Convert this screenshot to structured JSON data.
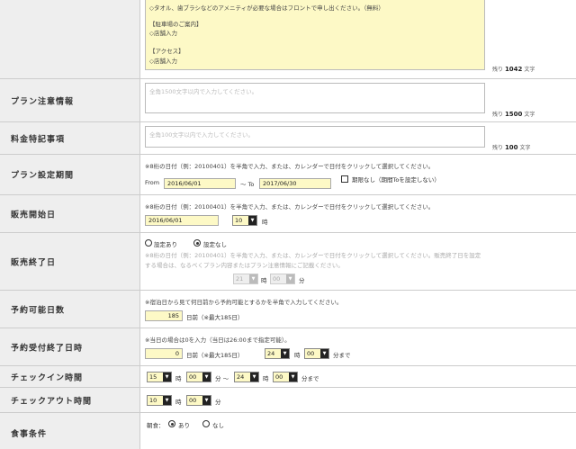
{
  "rows": {
    "top": {
      "lines": [
        "◇タオル、歯ブラシなどのアメニティが必要な場合はフロントで申し出ください。（無料）",
        "",
        "【駐車場のご案内】",
        "◇店舗入力",
        "",
        "【アクセス】",
        "◇店舗入力"
      ],
      "remain_prefix": "残り",
      "remain_count": "1042",
      "remain_suffix": "文字"
    },
    "plan_notes": {
      "label": "プラン注意情報",
      "placeholder": "全角1500文字以内で入力してください。",
      "remain_prefix": "残り",
      "remain_count": "1500",
      "remain_suffix": "文字"
    },
    "fee_notes": {
      "label": "料金特記事項",
      "placeholder": "全角100文字以内で入力してください。",
      "remain_prefix": "残り",
      "remain_count": "100",
      "remain_suffix": "文字"
    },
    "plan_period": {
      "label": "プラン設定期間",
      "note": "※8桁の日付（例：20100401）を半角で入力、または、カレンダーで日付をクリックして選択してください。",
      "from_label": "From",
      "from_value": "2016/06/01",
      "to_label": "～ To",
      "to_value": "2017/06/30",
      "no_limit_label": "期限なし（期間Toを設定しない）"
    },
    "sale_start": {
      "label": "販売開始日",
      "note": "※8桁の日付（例：20100401）を半角で入力、または、カレンダーで日付をクリックして選択してください。",
      "date_value": "2016/06/01",
      "hour_value": "10",
      "hour_unit": "時"
    },
    "sale_end": {
      "label": "販売終了日",
      "radio_set": "設定あり",
      "radio_unset": "設定なし",
      "note1": "※8桁の日付（例：20100401）を半角で入力、または、カレンダーで日付をクリックして選択してください。販売終了日を設定",
      "note2": "する場合は、なるべくプラン内容またはプラン注意情報にご記載ください。",
      "hour_value": "21",
      "hour_unit": "時",
      "min_value": "00",
      "min_unit": "分"
    },
    "booking_days": {
      "label": "予約可能日数",
      "note": "※宿泊日から見て何日前から予約可能とするかを半角で入力してください。",
      "value": "185",
      "suffix": "日前（※最大185日）"
    },
    "booking_deadline": {
      "label": "予約受付終了日時",
      "note": "※当日の場合は0を入力（当日は26:00まで指定可能）。",
      "value": "0",
      "suffix": "日前（※最大185日）",
      "hour_value": "24",
      "hour_unit": "時",
      "min_value": "00",
      "min_unit": "分まで"
    },
    "checkin": {
      "label": "チェックイン時間",
      "from_hour": "15",
      "hour_unit": "時",
      "from_min": "00",
      "min_unit_sep": "分 ～",
      "to_hour": "24",
      "hour_unit2": "時",
      "to_min": "00",
      "min_unit_end": "分まで"
    },
    "checkout": {
      "label": "チェックアウト時間",
      "hour": "10",
      "hour_unit": "時",
      "min": "00",
      "min_unit": "分"
    },
    "meals": {
      "label": "食事条件",
      "breakfast_label": "朝食：",
      "opt_yes": "あり",
      "opt_no": "なし"
    }
  }
}
